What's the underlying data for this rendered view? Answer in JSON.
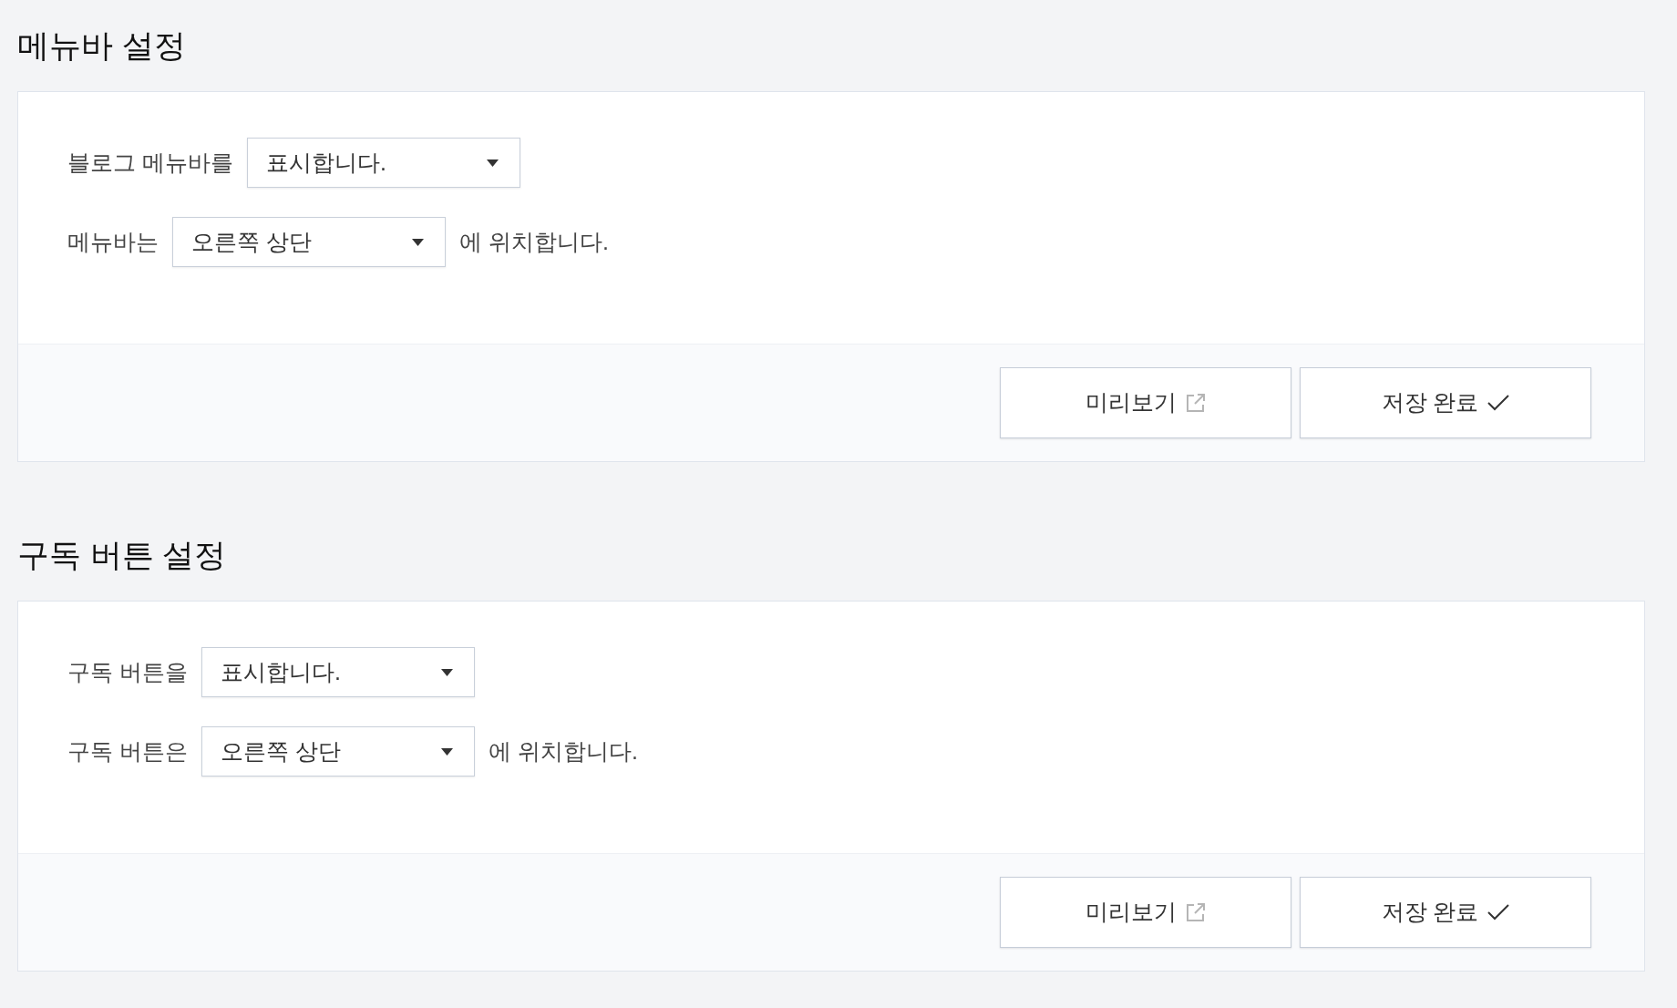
{
  "sections": [
    {
      "title": "메뉴바 설정",
      "rows": [
        {
          "label": "블로그 메뉴바를",
          "select": {
            "value": "표시합니다."
          }
        },
        {
          "label": "메뉴바는",
          "select": {
            "value": "오른쪽 상단"
          },
          "suffix": "에 위치합니다."
        }
      ],
      "buttons": [
        {
          "kind": "preview",
          "label": "미리보기"
        },
        {
          "kind": "save",
          "label": "저장 완료"
        }
      ]
    },
    {
      "title": "구독 버튼 설정",
      "rows": [
        {
          "label": "구독 버튼을",
          "select": {
            "value": "표시합니다."
          }
        },
        {
          "label": "구독 버튼은",
          "select": {
            "value": "오른쪽 상단"
          },
          "suffix": "에 위치합니다."
        }
      ],
      "buttons": [
        {
          "kind": "preview",
          "label": "미리보기"
        },
        {
          "kind": "save",
          "label": "저장 완료"
        }
      ]
    }
  ]
}
